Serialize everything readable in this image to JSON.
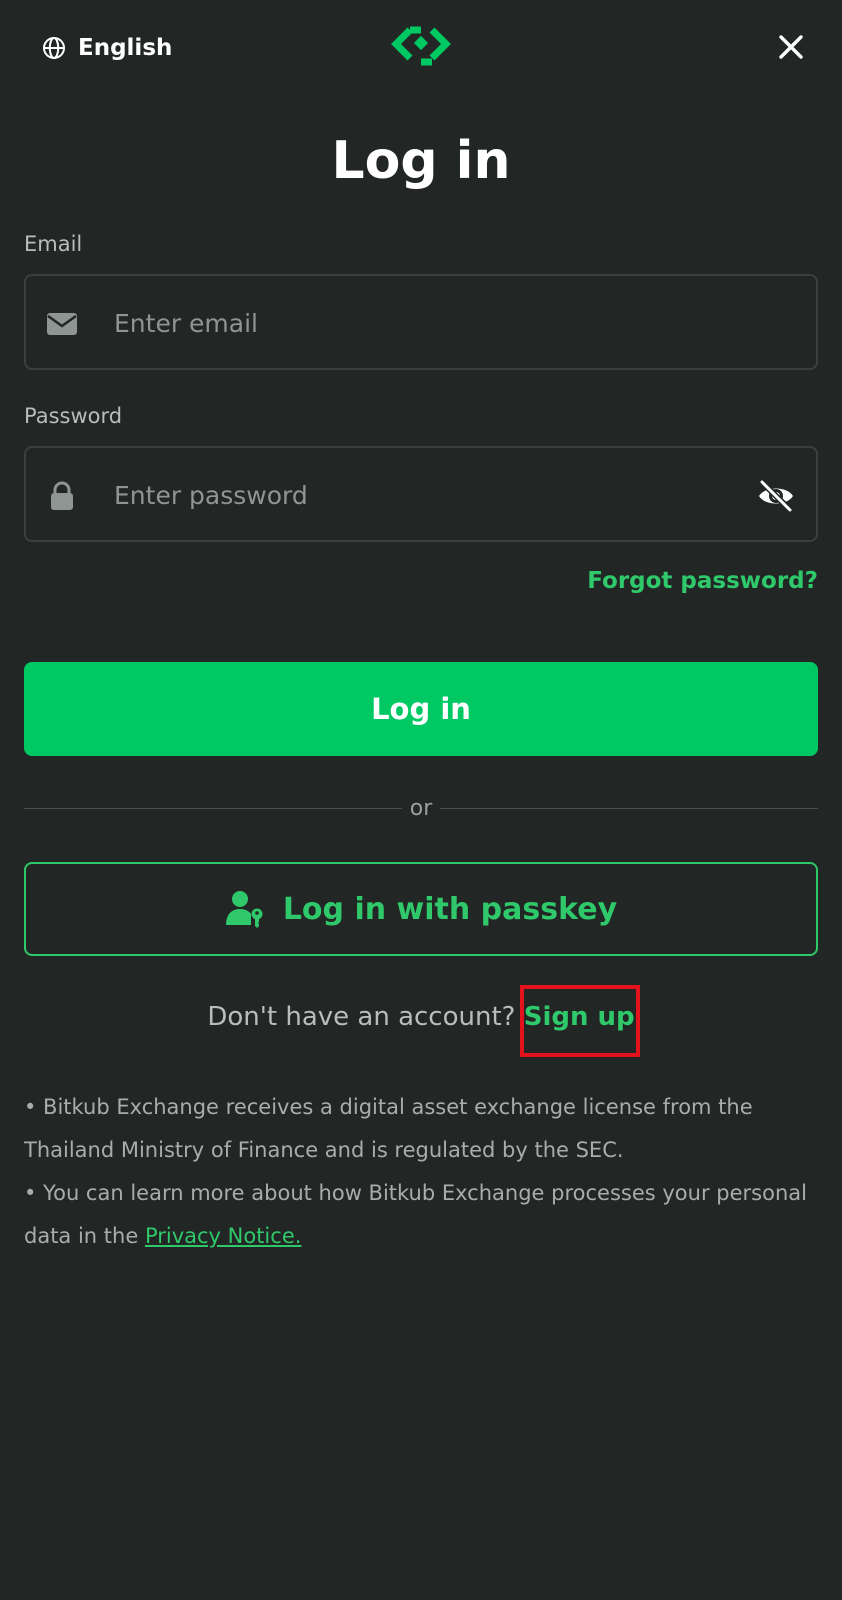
{
  "header": {
    "language_label": "English",
    "language_icon": "globe-icon",
    "logo_icon": "bitkub-logo-icon",
    "close_icon": "close-icon"
  },
  "title": "Log in",
  "email": {
    "label": "Email",
    "placeholder": "Enter email",
    "value": "",
    "icon": "envelope-icon"
  },
  "password": {
    "label": "Password",
    "placeholder": "Enter password",
    "value": "",
    "icon": "lock-icon",
    "toggle_icon": "eye-off-icon"
  },
  "forgot_password_label": "Forgot password?",
  "login_button_label": "Log in",
  "divider_label": "or",
  "passkey_button": {
    "label": "Log in with passkey",
    "icon": "user-key-icon"
  },
  "signup": {
    "prompt": "Don't have an account?",
    "link_label": "Sign up"
  },
  "notice": {
    "line1": "• Bitkub Exchange receives a digital asset exchange license from the Thailand Ministry of Finance and is regulated by the SEC.",
    "line2_prefix": "• You can learn more about how Bitkub Exchange processes your personal data in the ",
    "privacy_link": "Privacy Notice."
  },
  "colors": {
    "background": "#222725",
    "accent_green": "#00c964",
    "link_green": "#2fc86a",
    "highlight_red": "#e3121c"
  }
}
